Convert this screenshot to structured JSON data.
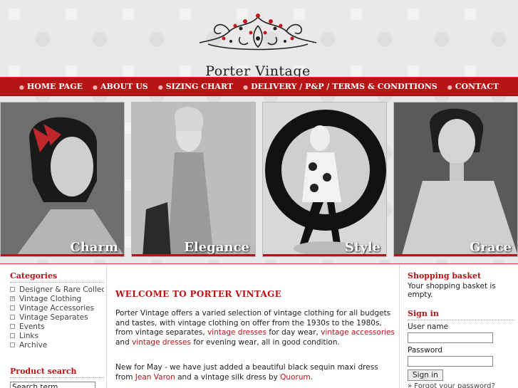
{
  "logo": {
    "text": "Porter Vintage"
  },
  "nav": [
    {
      "label": "HOME PAGE"
    },
    {
      "label": "ABOUT US"
    },
    {
      "label": "SIZING CHART"
    },
    {
      "label": "DELIVERY / P&P / TERMS & CONDITIONS"
    },
    {
      "label": "CONTACT"
    }
  ],
  "hero": [
    {
      "label": "Charm"
    },
    {
      "label": "Elegance"
    },
    {
      "label": "Style"
    },
    {
      "label": "Grace"
    }
  ],
  "categories": {
    "heading": "Categories",
    "items": [
      {
        "label": "Designer & Rare Collection",
        "icon": "box"
      },
      {
        "label": "Vintage Clothing",
        "icon": "plus-box"
      },
      {
        "label": "Vintage Accessories",
        "icon": "box"
      },
      {
        "label": "Vintage Separates",
        "icon": "box"
      },
      {
        "label": "Events",
        "icon": "box"
      },
      {
        "label": "Links",
        "icon": "box"
      },
      {
        "label": "Archive",
        "icon": "box"
      }
    ]
  },
  "product_search": {
    "heading": "Product search",
    "value": "Search term"
  },
  "main": {
    "welcome": "WELCOME TO PORTER VINTAGE",
    "p1_a": "Porter Vintage offers a varied selection of vintage clothing for all budgets and tastes, with vintage clothing on offer from the 1930s to the 1980s, from vintage separates, ",
    "p1_link1": "vintage dresses",
    "p1_b": " for day wear, ",
    "p1_link2": "vintage accessories",
    "p1_c": " and ",
    "p1_link3": "vintage dresses",
    "p1_d": " for evening wear, all in good condition.",
    "p2_a": "New for May - we have just added a beautiful black sequin maxi dress from ",
    "p2_link1": "Jean Varon",
    "p2_b": " and a vintage silk dress by ",
    "p2_link2": "Quorum",
    "p2_c": "."
  },
  "basket": {
    "heading": "Shopping basket",
    "text": "Your shopping basket is empty."
  },
  "signin": {
    "heading": "Sign in",
    "user_label": "User name",
    "pass_label": "Password",
    "button": "Sign in",
    "forgot": "» Forgot your password?"
  },
  "colors": {
    "accent": "#b81416"
  }
}
